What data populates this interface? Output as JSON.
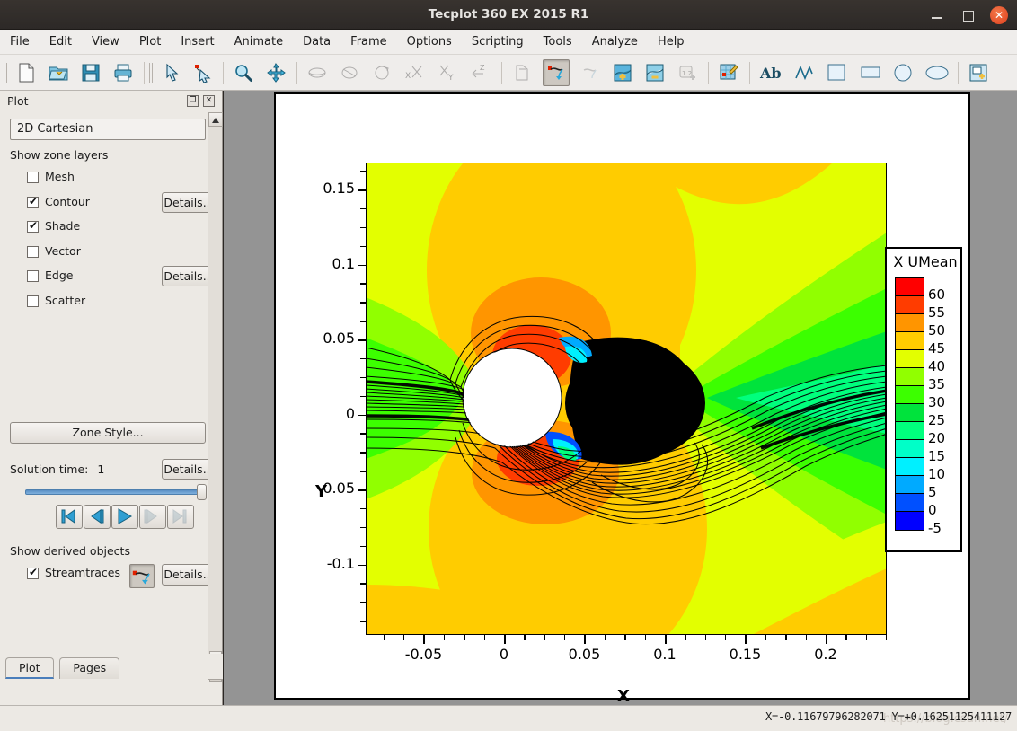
{
  "window": {
    "title": "Tecplot 360 EX 2015 R1",
    "minimize_label": "–",
    "maximize_label": "□",
    "close_label": "✕"
  },
  "menu": {
    "items": [
      {
        "label": "File"
      },
      {
        "label": "Edit"
      },
      {
        "label": "View"
      },
      {
        "label": "Plot"
      },
      {
        "label": "Insert"
      },
      {
        "label": "Animate"
      },
      {
        "label": "Data"
      },
      {
        "label": "Frame"
      },
      {
        "label": "Options"
      },
      {
        "label": "Scripting"
      },
      {
        "label": "Tools"
      },
      {
        "label": "Analyze"
      },
      {
        "label": "Help"
      }
    ]
  },
  "toolbar": {
    "icons": [
      "new-file-icon",
      "open-folder-icon",
      "save-icon",
      "print-icon",
      "select-arrow-icon",
      "adjust-arrow-icon",
      "zoom-icon",
      "pan-icon",
      "rotate-spherical-icon",
      "rotate-roller-icon",
      "rotate-twist-icon",
      "rotate-x-icon",
      "rotate-y-icon",
      "rotate-z-icon",
      "translate-3d-icon",
      "streamtrace-add-icon",
      "streamtrace-remove-icon",
      "contour-add-icon",
      "contour-remove-icon",
      "slice-add-icon",
      "probe-icon",
      "text-icon",
      "polyline-icon",
      "rectangle-icon",
      "square-icon",
      "circle-icon",
      "ellipse-icon",
      "frame-add-icon"
    ]
  },
  "sidebar": {
    "panel_title": "Plot",
    "float_icon": "float-panel-icon",
    "close_icon": "close-panel-icon",
    "plot_type": "2D Cartesian",
    "zone_layers_label": "Show zone layers",
    "zone_layers": [
      {
        "label": "Mesh",
        "checked": false,
        "details": null
      },
      {
        "label": "Contour",
        "checked": true,
        "details": "Details..."
      },
      {
        "label": "Shade",
        "checked": true,
        "details": null
      },
      {
        "label": "Vector",
        "checked": false,
        "details": null
      },
      {
        "label": "Edge",
        "checked": false,
        "details": "Details..."
      },
      {
        "label": "Scatter",
        "checked": false,
        "details": null
      }
    ],
    "zone_style_label": "Zone Style...",
    "solution_time_label": "Solution time:",
    "solution_time_value": "1",
    "solution_time_details": "Details...",
    "playback": [
      {
        "name": "skip-to-start-button",
        "glyph": "first",
        "enabled": true
      },
      {
        "name": "step-back-button",
        "glyph": "prev",
        "enabled": true
      },
      {
        "name": "play-button",
        "glyph": "play",
        "enabled": true
      },
      {
        "name": "step-forward-button",
        "glyph": "next",
        "enabled": false
      },
      {
        "name": "skip-to-end-button",
        "glyph": "last",
        "enabled": false
      }
    ],
    "derived_objects_label": "Show derived objects",
    "streamtraces": {
      "label": "Streamtraces",
      "checked": true,
      "details": "Details..."
    },
    "tabs": [
      {
        "label": "Plot",
        "active": true
      },
      {
        "label": "Pages",
        "active": false
      }
    ]
  },
  "statusbar": {
    "coords": "X=-0.11679796282071  Y=+0.16251125411127",
    "watermark": "https://blog.csdn.net/"
  },
  "chart_data": {
    "type": "heatmap",
    "title": "",
    "xlabel": "X",
    "ylabel": "Y",
    "xlim": [
      -0.086,
      0.238
    ],
    "ylim": [
      -0.147,
      0.168
    ],
    "xticks": [
      -0.05,
      0,
      0.05,
      0.1,
      0.15,
      0.2
    ],
    "xtick_labels": [
      "-0.05",
      "0",
      "0.05",
      "0.1",
      "0.15",
      "0.2"
    ],
    "yticks": [
      0.15,
      0.1,
      0.05,
      0,
      -0.05,
      -0.1
    ],
    "ytick_labels": [
      "0.15",
      "0.1",
      "0.05",
      "0",
      "-0.05",
      "-0.1"
    ],
    "minor_tick_step": 0.0125,
    "grid": false,
    "legend": {
      "title": "X UMean",
      "position": "right",
      "levels": [
        60,
        55,
        50,
        45,
        40,
        35,
        30,
        25,
        20,
        15,
        10,
        5,
        0,
        -5
      ],
      "colors": [
        "#ff0000",
        "#ff3c00",
        "#ff9500",
        "#ffcc00",
        "#e3ff00",
        "#91ff00",
        "#3cff00",
        "#00e33c",
        "#00ff7d",
        "#00ffc8",
        "#00f0ff",
        "#00aaff",
        "#0050ff",
        "#0000ff"
      ]
    },
    "field_variable": "X UMean",
    "value_range": [
      -5,
      60
    ],
    "overlays": [
      {
        "name": "streamtraces",
        "color": "#000000",
        "description": "dense streamlines around cylinder and wake"
      },
      {
        "name": "cylinder",
        "color": "#ffffff",
        "description": "white circular body at approximately x=0.0, y=0.0"
      },
      {
        "name": "wake-region",
        "color": "#000000",
        "description": "dense black recirculation wake downstream of cylinder"
      }
    ]
  }
}
